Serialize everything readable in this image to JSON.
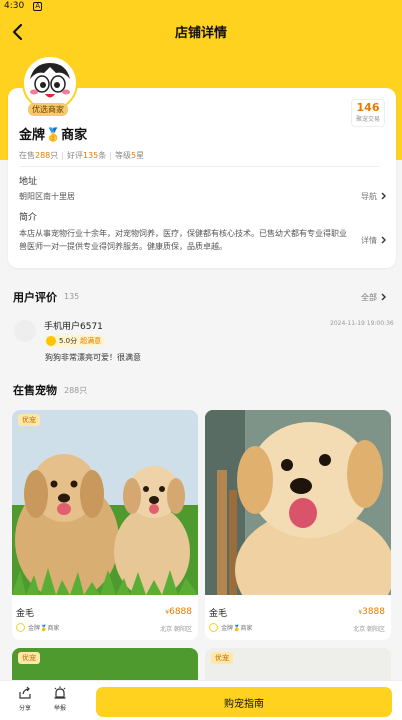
{
  "status": {
    "time": "4:30",
    "badge": "A"
  },
  "header": {
    "title": "店铺详情"
  },
  "shop": {
    "badge": "优选商家",
    "name": "金牌🥇商家",
    "sold_count": "146",
    "sold_label": "聚宠交易",
    "stats": {
      "on_sale_prefix": "在售",
      "on_sale_value": "288",
      "on_sale_unit": "只",
      "good_prefix": "好评",
      "good_value": "135",
      "good_unit": "条",
      "level_prefix": "等级",
      "level_value": "5",
      "level_unit": "星"
    },
    "address_label": "地址",
    "address": "朝阳区南十里居",
    "navigate_label": "导航",
    "intro_label": "简介",
    "intro": "本店从事宠物行业十余年，对宠物饲养，医疗，保健都有核心技术。已售幼犬都有专业得职业兽医师一对一提供专业得饲养服务。健康质保，品质卓越。",
    "details_label": "详情"
  },
  "reviews": {
    "title": "用户评价",
    "count": "135",
    "all_label": "全部",
    "items": [
      {
        "user": "手机用户6571",
        "time": "2024-11-19 19:00:36",
        "score": "5.0分",
        "level": "超满意",
        "text": "狗狗非常漂亮可爱！很满意"
      }
    ]
  },
  "pets": {
    "title": "在售宠物",
    "count": "288只",
    "items": [
      {
        "tag": "优宠",
        "name": "金毛",
        "currency": "¥",
        "price": "6888",
        "seller": "金牌🥇商家",
        "location": "北京 朝阳区"
      },
      {
        "tag": "",
        "name": "金毛",
        "currency": "¥",
        "price": "3888",
        "seller": "金牌🥇商家",
        "location": "北京 朝阳区"
      },
      {
        "tag": "优宠"
      },
      {
        "tag": "优宠"
      }
    ]
  },
  "bottom_bar": {
    "share_label": "分享",
    "report_label": "举报",
    "guide_label": "购宠指南"
  },
  "colors": {
    "brand": "#ffd21f",
    "accent": "#e57b00"
  }
}
